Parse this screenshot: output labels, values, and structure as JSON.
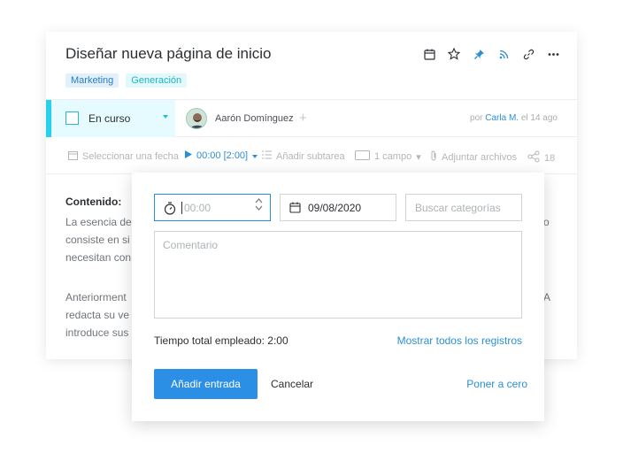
{
  "task": {
    "title": "Diseñar nueva página de inicio",
    "tags": [
      "Marketing",
      "Generación"
    ],
    "status": "En curso",
    "assignee": "Aarón Domínguez",
    "meta_prefix": "por",
    "meta_author": "Carla M.",
    "meta_suffix": "el 14 ago"
  },
  "action_bar": {
    "select_date": "Seleccionar una fecha",
    "timer": "00:00 [2:00]",
    "add_subtask": "Añadir subtarea",
    "fields": "1 campo",
    "attach": "Adjuntar archivos",
    "shares": "18"
  },
  "content": {
    "heading": "Contenido:",
    "p1_lines": [
      "La esencia de",
      "consiste en si",
      "necesitan con"
    ],
    "p1_right": "o",
    "p2_lines": [
      "Anteriorment",
      "redacta su ve",
      "introduce sus"
    ],
    "p2_right": "A"
  },
  "time_entry": {
    "time_placeholder": "00:00",
    "date": "09/08/2020",
    "category_placeholder": "Buscar categorías",
    "comment_placeholder": "Comentario",
    "total": "Tiempo total empleado: 2:00",
    "show_all": "Mostrar todos los registros",
    "add_entry": "Añadir entrada",
    "cancel": "Cancelar",
    "reset": "Poner a cero"
  },
  "colors": {
    "accent": "#2b8fe6",
    "status_bar": "#27d1ec"
  }
}
